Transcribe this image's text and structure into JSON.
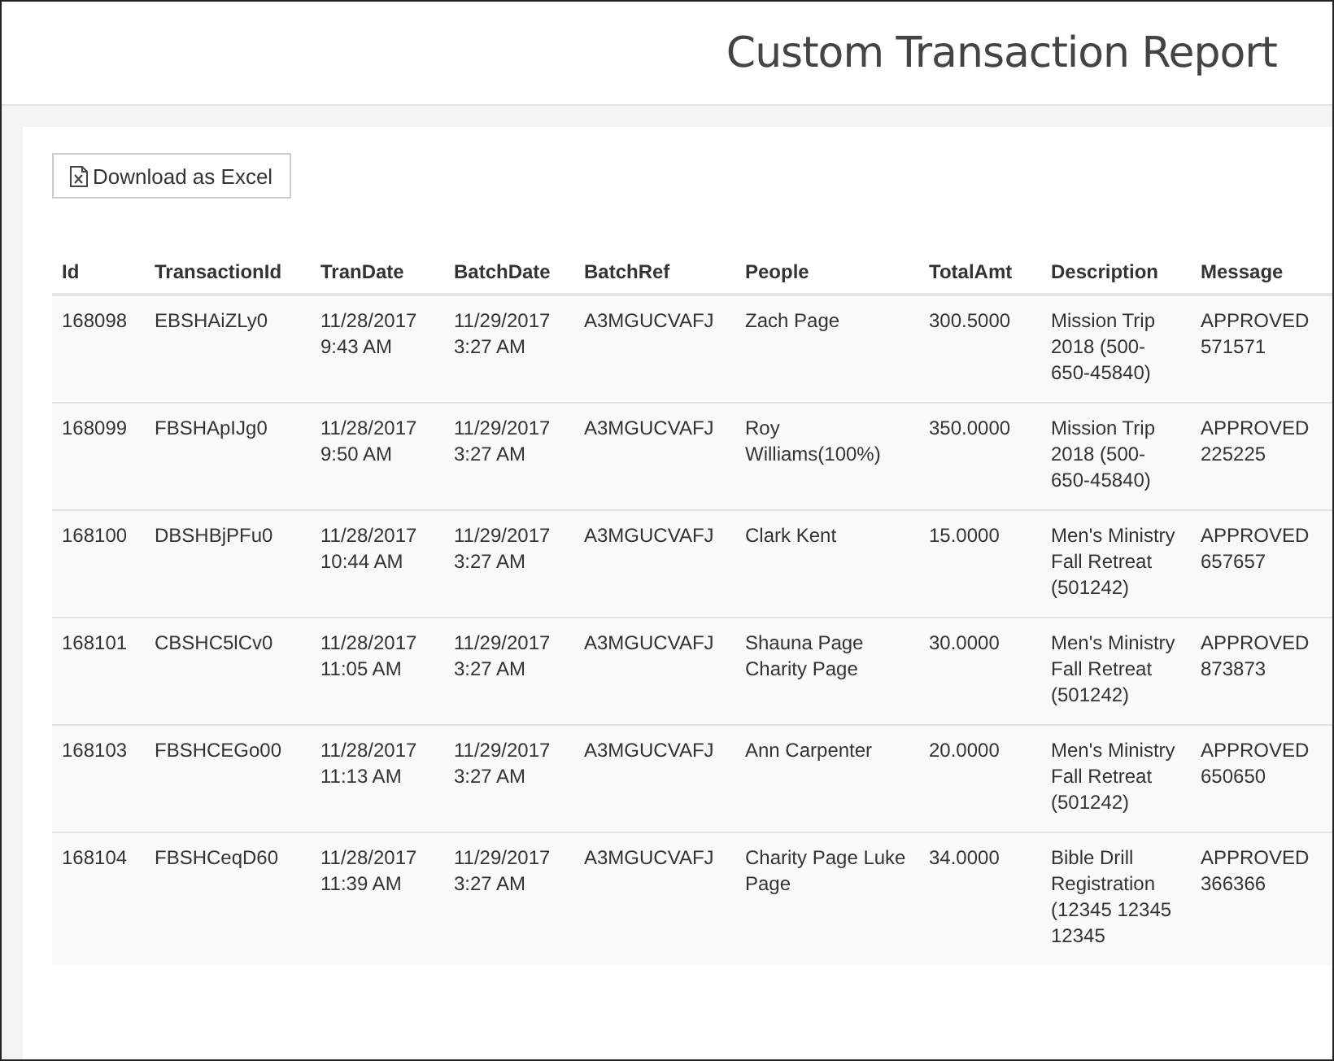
{
  "header": {
    "title": "Custom Transaction Report"
  },
  "toolbar": {
    "download_button": "Download as Excel"
  },
  "table": {
    "columns": [
      "Id",
      "TransactionId",
      "TranDate",
      "BatchDate",
      "BatchRef",
      "People",
      "TotalAmt",
      "Description",
      "Message"
    ],
    "rows": [
      [
        "168098",
        "EBSHAiZLy0",
        "11/28/2017 9:43 AM",
        "11/29/2017 3:27 AM",
        "A3MGUCVAFJ",
        "Zach Page",
        "300.5000",
        "Mission Trip 2018 (500-650-45840)",
        "APPROVED 571571"
      ],
      [
        "168099",
        "FBSHApIJg0",
        "11/28/2017 9:50 AM",
        "11/29/2017 3:27 AM",
        "A3MGUCVAFJ",
        "Roy Williams(100%)",
        "350.0000",
        "Mission Trip 2018 (500-650-45840)",
        "APPROVED 225225"
      ],
      [
        "168100",
        "DBSHBjPFu0",
        "11/28/2017 10:44 AM",
        "11/29/2017 3:27 AM",
        "A3MGUCVAFJ",
        "Clark Kent",
        "15.0000",
        "Men's Ministry Fall Retreat (501242)",
        "APPROVED 657657"
      ],
      [
        "168101",
        "CBSHC5lCv0",
        "11/28/2017 11:05 AM",
        "11/29/2017 3:27 AM",
        "A3MGUCVAFJ",
        "Shauna Page Charity Page",
        "30.0000",
        "Men's Ministry Fall Retreat (501242)",
        "APPROVED 873873"
      ],
      [
        "168103",
        "FBSHCEGo00",
        "11/28/2017 11:13 AM",
        "11/29/2017 3:27 AM",
        "A3MGUCVAFJ",
        "Ann Carpenter",
        "20.0000",
        "Men's Ministry Fall Retreat (501242)",
        "APPROVED 650650"
      ],
      [
        "168104",
        "FBSHCeqD60",
        "11/28/2017 11:39 AM",
        "11/29/2017 3:27 AM",
        "A3MGUCVAFJ",
        "Charity Page Luke Page",
        "34.0000",
        "Bible Drill Registration (12345 12345 12345",
        "APPROVED 366366"
      ]
    ]
  }
}
